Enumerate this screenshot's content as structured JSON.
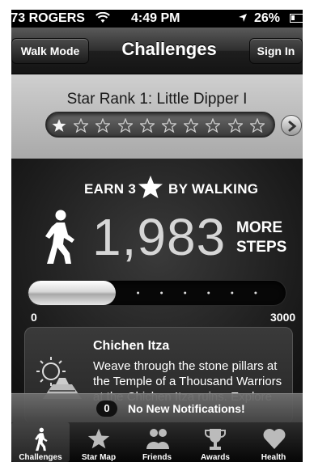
{
  "status_bar": {
    "carrier": "-73 ROGERS",
    "time": "4:49 PM",
    "battery": "26%",
    "icons": [
      "wifi-icon",
      "location-arrow-icon",
      "battery-icon"
    ]
  },
  "nav": {
    "left_button": "Walk Mode",
    "title": "Challenges",
    "right_button": "Sign In"
  },
  "rank": {
    "title": "Star Rank 1: Little Dipper I",
    "stars_total": 10,
    "stars_earned": 1,
    "next_icon": "chevron-right-icon"
  },
  "challenge": {
    "earn_prefix": "EARN 3",
    "earn_suffix": "BY WALKING",
    "steps": "1,983",
    "more_label_line1": "MORE",
    "more_label_line2": "STEPS",
    "progress": {
      "min": "0",
      "max": "3000",
      "current": 1017
    }
  },
  "info_card": {
    "title": "Chichen Itza",
    "text": "Weave through the stone pillars at the Temple of a Thousand Warriors at the Chichen Itza ruins. Explore",
    "icon": "temple-icon"
  },
  "notification": {
    "count": "0",
    "text": "No New Notifications!"
  },
  "tabs": [
    {
      "label": "Challenges",
      "icon": "walker-icon",
      "selected": true
    },
    {
      "label": "Star Map",
      "icon": "star-icon",
      "selected": false
    },
    {
      "label": "Friends",
      "icon": "friends-icon",
      "selected": false
    },
    {
      "label": "Awards",
      "icon": "trophy-icon",
      "selected": false
    },
    {
      "label": "Health",
      "icon": "heart-icon",
      "selected": false
    }
  ],
  "colors": {
    "nav_bg": "#2e2e2e",
    "panel_bg": "#bdbdbd",
    "challenge_bg": "#1c1c1c",
    "progress_fill": "#e6e6e6",
    "text_light": "#ffffff"
  }
}
